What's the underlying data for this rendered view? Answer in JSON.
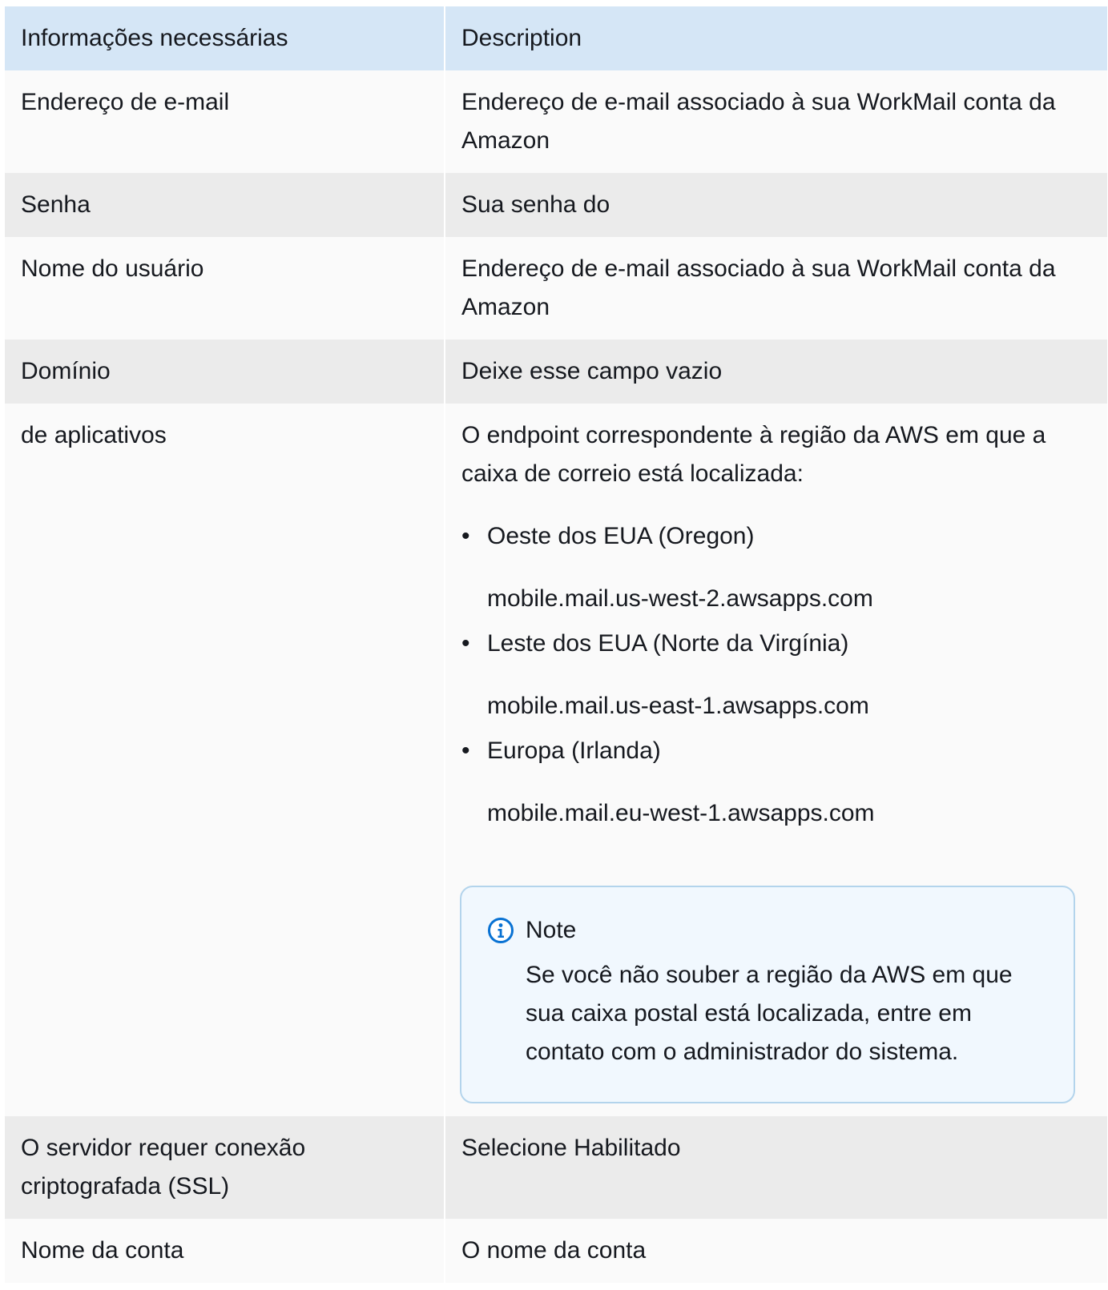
{
  "table": {
    "headers": [
      "Informações necessárias",
      "Description"
    ],
    "rows": [
      {
        "label": "Endereço de e-mail",
        "value": "Endereço de e-mail associado à sua WorkMail conta da Amazon"
      },
      {
        "label": "Senha",
        "value": "Sua senha do"
      },
      {
        "label": "Nome do usuário",
        "value": "Endereço de e-mail associado à sua WorkMail conta da Amazon"
      },
      {
        "label": "Domínio",
        "value": "Deixe esse campo vazio"
      },
      {
        "label": "de aplicativos",
        "value": "O endpoint correspondente à região da AWS em que a caixa de correio está localizada:",
        "regions": [
          {
            "name": "Oeste dos EUA (Oregon)",
            "endpoint": "mobile.mail.us-west-2.awsapps.com"
          },
          {
            "name": "Leste dos EUA (Norte da Virgínia)",
            "endpoint": "mobile.mail.us-east-1.awsapps.com"
          },
          {
            "name": "Europa (Irlanda)",
            "endpoint": "mobile.mail.eu-west-1.awsapps.com"
          }
        ],
        "note": {
          "title": "Note",
          "text": "Se você não souber a região da AWS em que sua caixa postal está localizada, entre em contato com o administrador do sistema.",
          "icon": "info-icon"
        }
      },
      {
        "label": "O servidor requer conexão criptografada (SSL)",
        "value": "Selecione Habilitado"
      },
      {
        "label": "Nome da conta",
        "value": "O nome da conta"
      }
    ]
  },
  "bullet_glyph": "•",
  "colors": {
    "header_bg": "#d5e6f6",
    "row_light": "#fafafa",
    "row_dark": "#ebebeb",
    "note_border": "#b3d4ec",
    "note_bg": "#f1f8fe",
    "info_icon": "#0972d3"
  }
}
